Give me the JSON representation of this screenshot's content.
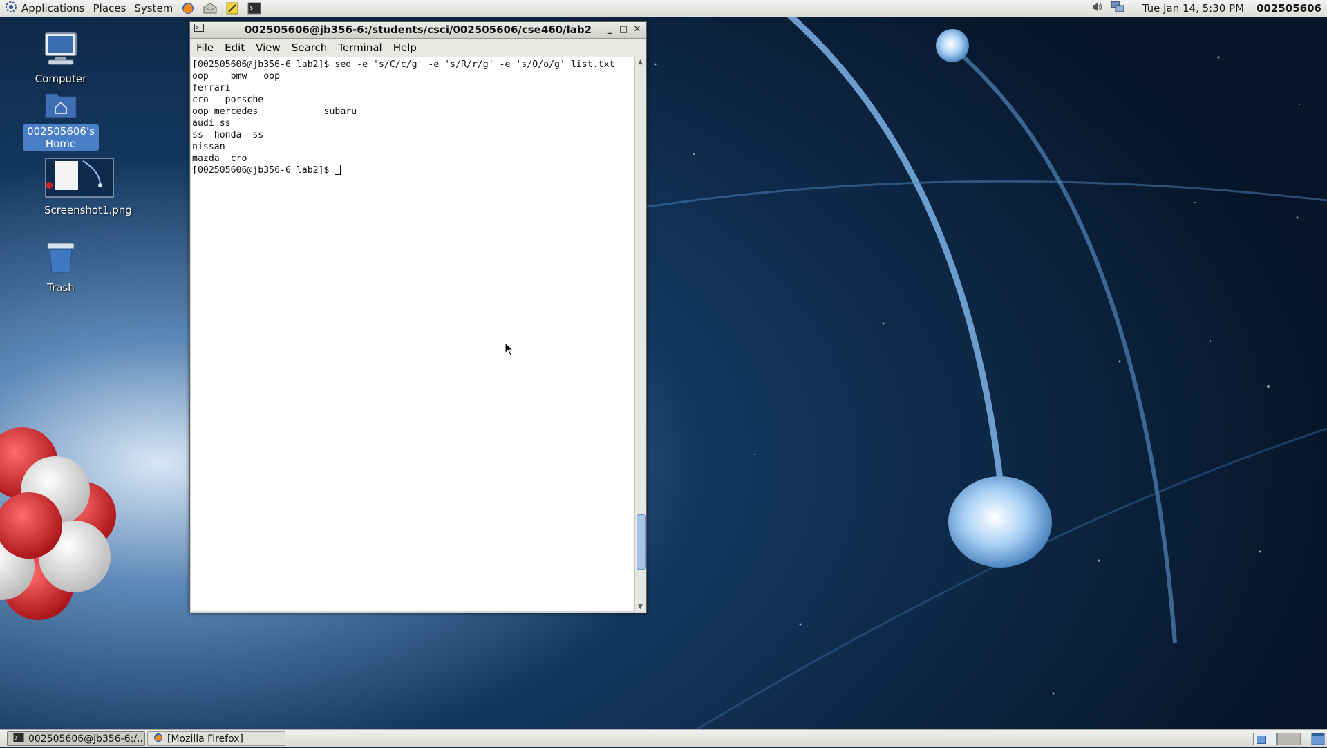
{
  "top_panel": {
    "menus": [
      "Applications",
      "Places",
      "System"
    ],
    "launchers": [
      "firefox-icon",
      "mail-icon",
      "text-editor-icon",
      "terminal-icon"
    ],
    "clock": "Tue Jan 14,  5:30 PM",
    "user": "002505606"
  },
  "desktop_icons": [
    {
      "label": "Computer",
      "icon": "computer-icon"
    },
    {
      "label": "002505606's Home",
      "icon": "home-folder-icon",
      "selected": true
    },
    {
      "label": "Screenshot1.png",
      "icon": "image-thumbnail-icon"
    },
    {
      "label": "Trash",
      "icon": "trash-icon"
    }
  ],
  "terminal": {
    "title": "002505606@jb356-6:/students/csci/002505606/cse460/lab2",
    "menus": [
      "File",
      "Edit",
      "View",
      "Search",
      "Terminal",
      "Help"
    ],
    "lines": [
      "[002505606@jb356-6 lab2]$ sed -e 's/C/c/g' -e 's/R/r/g' -e 's/O/o/g' list.txt",
      "oop    bmw   oop",
      "ferrari",
      "cro   porsche",
      "oop mercedes            subaru",
      "audi ss",
      "ss  honda  ss",
      "nissan",
      "mazda  cro"
    ],
    "prompt": "[002505606@jb356-6 lab2]$ ",
    "scroll_position": 0.93
  },
  "taskbar": {
    "tasks": [
      {
        "label": "002505606@jb356-6:/...",
        "icon": "terminal-icon",
        "active": true
      },
      {
        "label": "[Mozilla Firefox]",
        "icon": "firefox-icon",
        "active": false
      }
    ]
  },
  "colors": {
    "wallpaper_dark": "#071a33",
    "wallpaper_mid": "#0f3562",
    "selection": "#4a7fc8"
  }
}
